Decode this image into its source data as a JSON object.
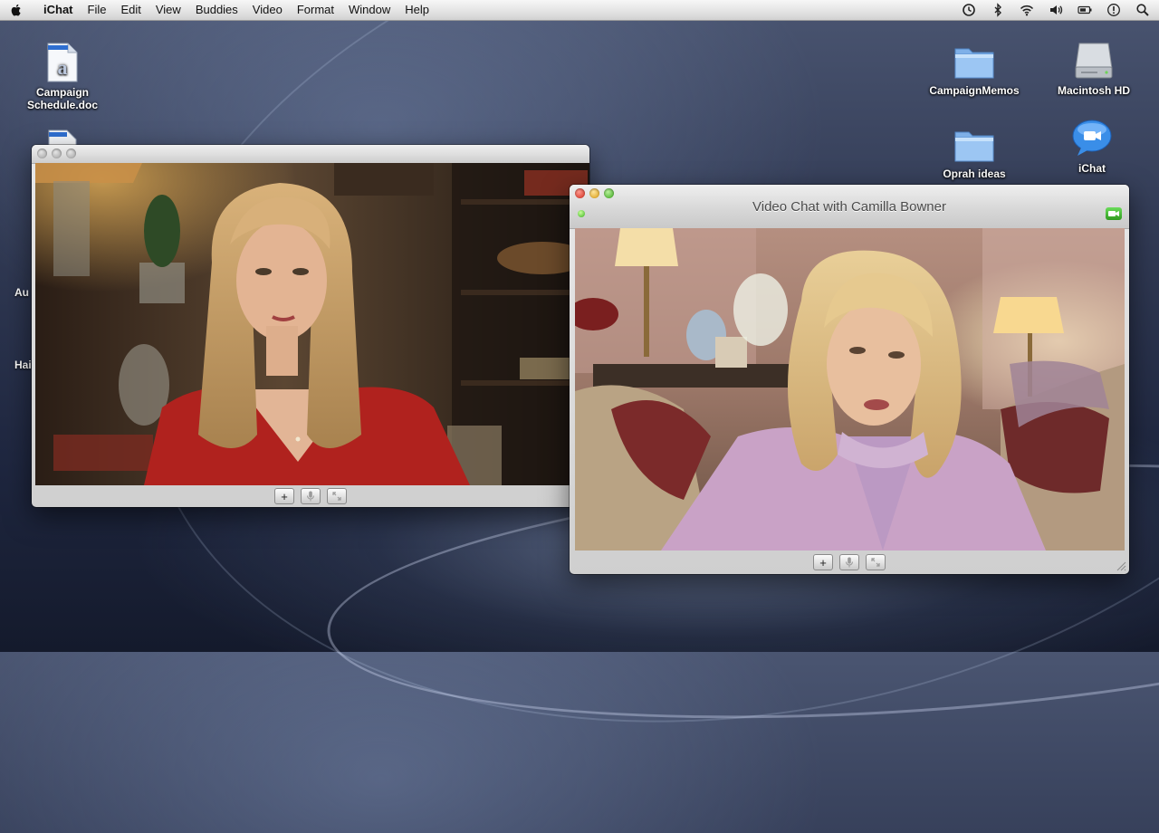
{
  "menubar": {
    "app_name": "iChat",
    "items": [
      "File",
      "Edit",
      "View",
      "Buddies",
      "Video",
      "Format",
      "Window",
      "Help"
    ]
  },
  "desktop": {
    "left_icons": [
      {
        "label_line1": "Campaign",
        "label_line2": "Schedule.doc",
        "icon": "word-document-icon"
      }
    ],
    "right_icons": [
      {
        "label": "CampaignMemos",
        "icon": "folder-icon"
      },
      {
        "label": "Macintosh HD",
        "icon": "hard-drive-icon"
      },
      {
        "label": "Oprah ideas",
        "icon": "folder-icon"
      },
      {
        "label": "iChat",
        "icon": "ichat-app-icon"
      }
    ]
  },
  "window_left": {
    "toolbar_icons": [
      "add-icon",
      "microphone-icon",
      "fullscreen-icon"
    ]
  },
  "window_right": {
    "title": "Video Chat with Camilla Bowner",
    "toolbar_icons": [
      "add-icon",
      "microphone-icon",
      "fullscreen-icon"
    ]
  },
  "colors": {
    "status_green": "#3bb01f",
    "close_red": "#d0291b",
    "minimize_yellow": "#d99a10",
    "zoom_green": "#3aa61c"
  }
}
